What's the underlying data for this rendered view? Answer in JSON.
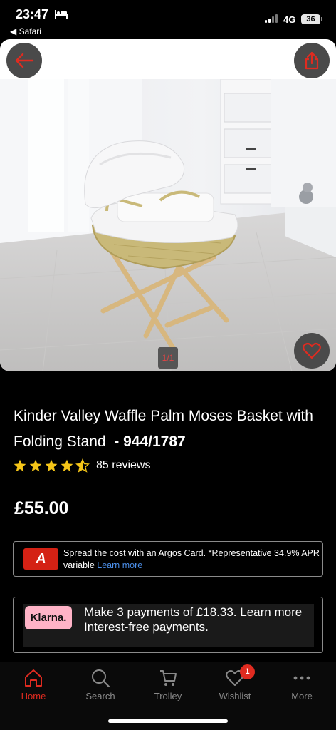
{
  "status_bar": {
    "time": "23:47",
    "back_app": "◀ Safari",
    "network": "4G",
    "battery": "36"
  },
  "gallery": {
    "pager": "1/1"
  },
  "product": {
    "title": "Kinder Valley Waffle Palm Moses Basket with Folding Stand",
    "code": "- 944/1787",
    "rating": 4.5,
    "reviews": "85 reviews",
    "price": "£55.00"
  },
  "argos_card": {
    "logo_letter": "A",
    "text": "Spread the cost with an Argos Card. *Representative 34.9% APR variable",
    "link": "Learn more"
  },
  "klarna": {
    "logo": "Klarna.",
    "line1": "Make 3 payments of £18.33.",
    "link": "Learn more",
    "line2": "Interest-free payments."
  },
  "nav": {
    "home": "Home",
    "search": "Search",
    "trolley": "Trolley",
    "wishlist": "Wishlist",
    "wishlist_badge": "1",
    "more": "More"
  },
  "colors": {
    "accent": "#e02b20",
    "argos_red": "#d42114",
    "klarna_pink": "#ffb3c7",
    "link_blue": "#4b8ee8"
  }
}
